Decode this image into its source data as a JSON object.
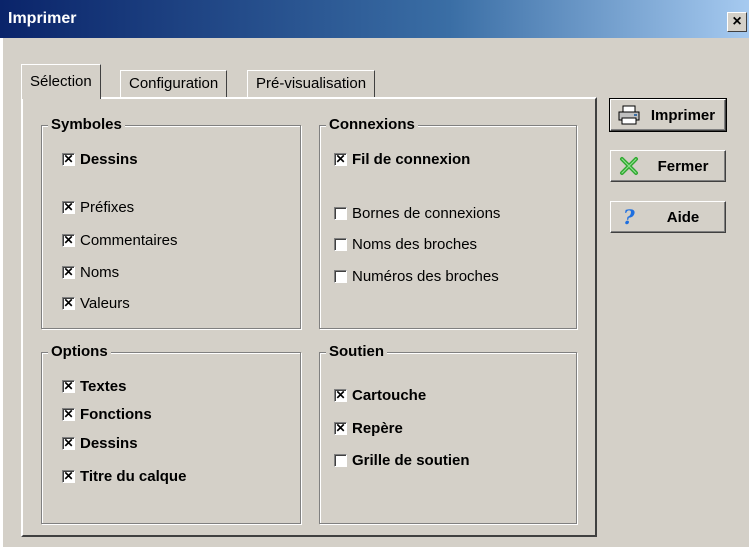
{
  "window": {
    "title": "Imprimer",
    "close_glyph": "×"
  },
  "tabs": [
    {
      "label": "Sélection",
      "active": true
    },
    {
      "label": "Configuration",
      "active": false
    },
    {
      "label": "Pré-visualisation",
      "active": false
    }
  ],
  "groups": {
    "symboles": {
      "title": "Symboles",
      "items": [
        {
          "label": "Dessins",
          "checked": true,
          "bold": true
        },
        {
          "label": "Préfixes",
          "checked": true,
          "bold": false
        },
        {
          "label": "Commentaires",
          "checked": true,
          "bold": false
        },
        {
          "label": "Noms",
          "checked": true,
          "bold": false
        },
        {
          "label": "Valeurs",
          "checked": true,
          "bold": false
        }
      ]
    },
    "connexions": {
      "title": "Connexions",
      "items": [
        {
          "label": "Fil de connexion",
          "checked": true,
          "bold": true
        },
        {
          "label": "Bornes de connexions",
          "checked": false,
          "bold": false
        },
        {
          "label": "Noms des broches",
          "checked": false,
          "bold": false
        },
        {
          "label": "Numéros des broches",
          "checked": false,
          "bold": false
        }
      ]
    },
    "options": {
      "title": "Options",
      "items": [
        {
          "label": "Textes",
          "checked": true,
          "bold": true
        },
        {
          "label": "Fonctions",
          "checked": true,
          "bold": true
        },
        {
          "label": "Dessins",
          "checked": true,
          "bold": true
        },
        {
          "label": "Titre du calque",
          "checked": true,
          "bold": true
        }
      ]
    },
    "soutien": {
      "title": "Soutien",
      "items": [
        {
          "label": "Cartouche",
          "checked": true,
          "bold": true
        },
        {
          "label": "Repère",
          "checked": true,
          "bold": true
        },
        {
          "label": "Grille de soutien",
          "checked": false,
          "bold": true
        }
      ]
    }
  },
  "buttons": {
    "print": {
      "label": "Imprimer",
      "icon": "printer-icon"
    },
    "close": {
      "label": "Fermer",
      "icon": "green-x-icon"
    },
    "help": {
      "label": "Aide",
      "icon": "question-mark-icon"
    }
  },
  "colors": {
    "titlebar_start": "#0a246a",
    "titlebar_end": "#a6caf0",
    "face": "#d4d0c8",
    "close_icon_green": "#2fa82f",
    "help_icon_blue": "#1e6fe0"
  }
}
